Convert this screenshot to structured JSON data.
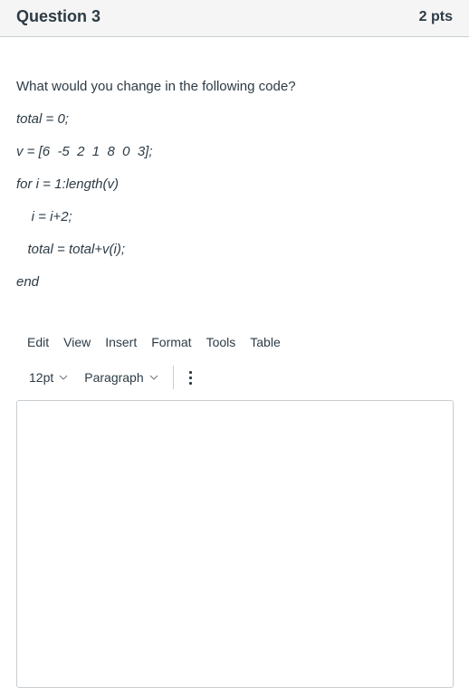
{
  "header": {
    "title": "Question 3",
    "points": "2 pts"
  },
  "question": {
    "prompt": "What would you change in the following code?",
    "code_lines": [
      "total = 0;",
      "v = [6  -5  2  1  8  0  3];",
      "for i = 1:length(v)",
      "    i = i+2;",
      "   total = total+v(i);",
      "end"
    ]
  },
  "editor": {
    "menu": [
      "Edit",
      "View",
      "Insert",
      "Format",
      "Tools",
      "Table"
    ],
    "font_size": "12pt",
    "block_format": "Paragraph",
    "more_icon": "kebab-vertical-icon",
    "content": ""
  }
}
